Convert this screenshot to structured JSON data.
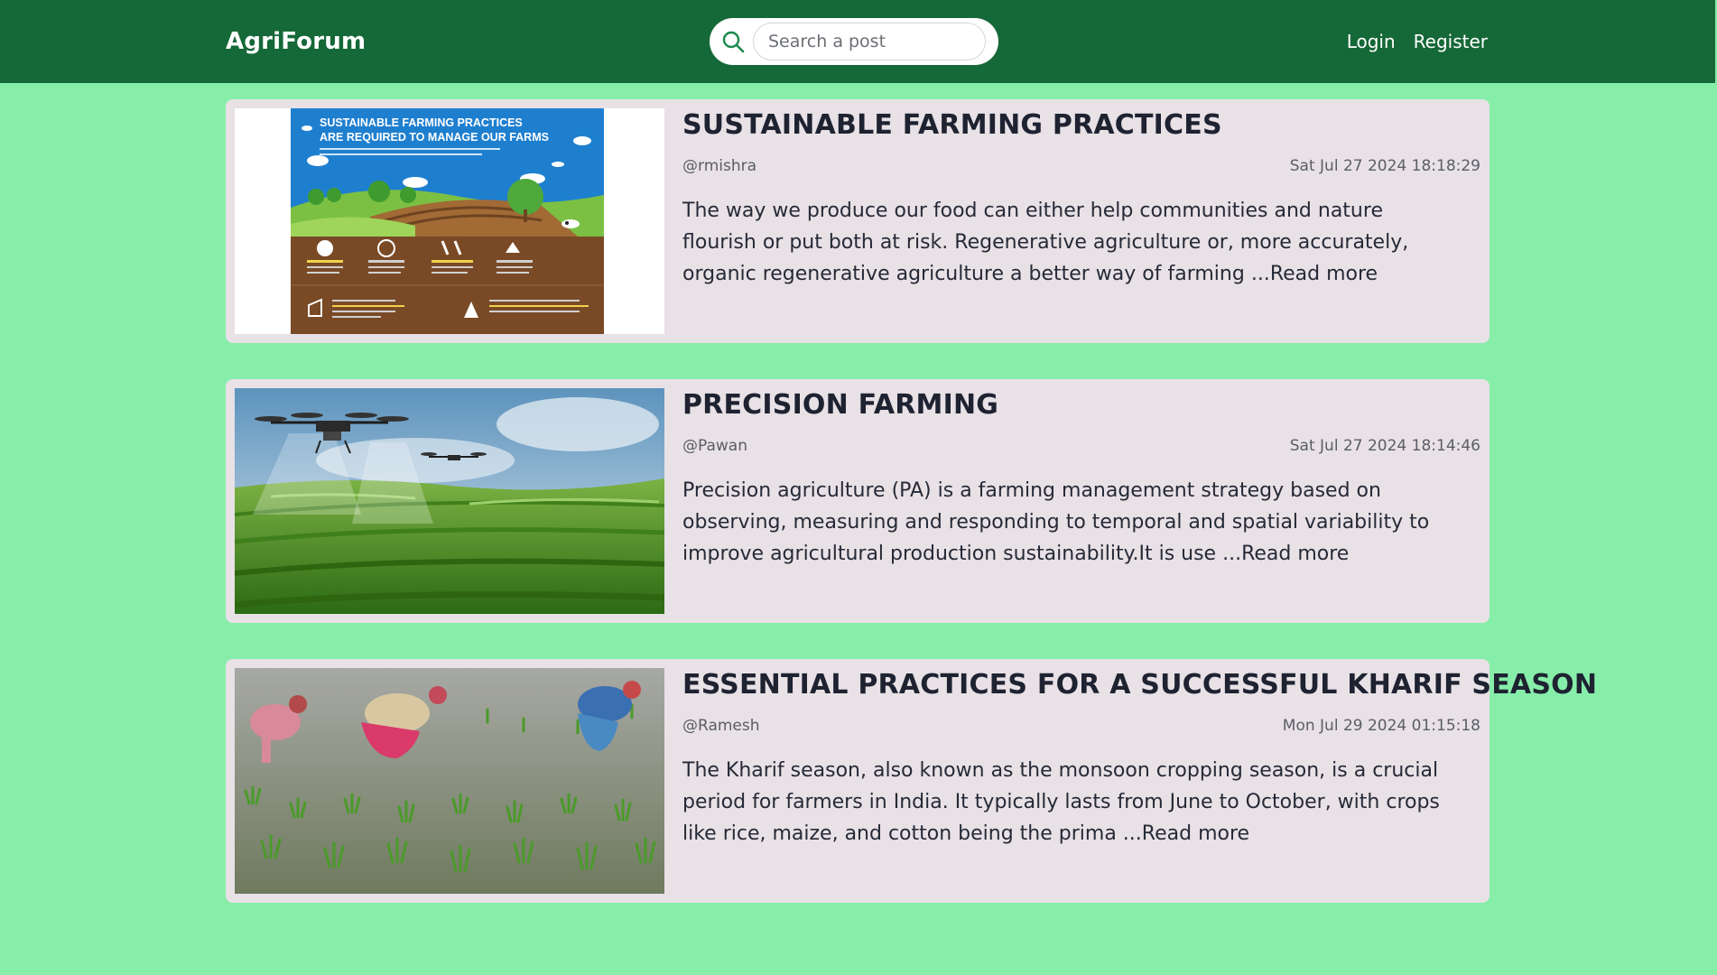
{
  "header": {
    "brand": "AgriForum",
    "search_placeholder": "Search a post",
    "login_label": "Login",
    "register_label": "Register"
  },
  "posts": [
    {
      "title": "SUSTAINABLE FARMING PRACTICES",
      "author": "@rmishra",
      "date": "Sat Jul 27 2024  18:18:29",
      "excerpt": "The way we produce our food can either help communities and nature flourish or put both at risk. Regenerative agriculture or, more accurately, organic regenerative agriculture a better way of farming ...",
      "read_more": "Read more",
      "image": {
        "heading_line1": "SUSTAINABLE FARMING PRACTICES",
        "heading_line2": "ARE REQUIRED TO MANAGE OUR FARMS"
      }
    },
    {
      "title": "PRECISION FARMING",
      "author": "@Pawan",
      "date": "Sat Jul 27 2024  18:14:46",
      "excerpt": "Precision agriculture (PA) is a farming management strategy based on observing, measuring and responding to temporal and spatial variability to improve agricultural production sustainability.It is use ...",
      "read_more": "Read more"
    },
    {
      "title": "ESSENTIAL PRACTICES FOR A SUCCESSFUL KHARIF SEASON",
      "author": "@Ramesh",
      "date": "Mon Jul 29 2024  01:15:18",
      "excerpt": "The Kharif season, also known as the monsoon cropping season, is a crucial period for farmers in India. It typically lasts from June to October, with crops like rice, maize, and cotton being the prima ...",
      "read_more": "Read more"
    }
  ],
  "colors": {
    "navbar": "#156837",
    "page_background": "#87eeaa",
    "card_background": "#e8e1e6"
  }
}
